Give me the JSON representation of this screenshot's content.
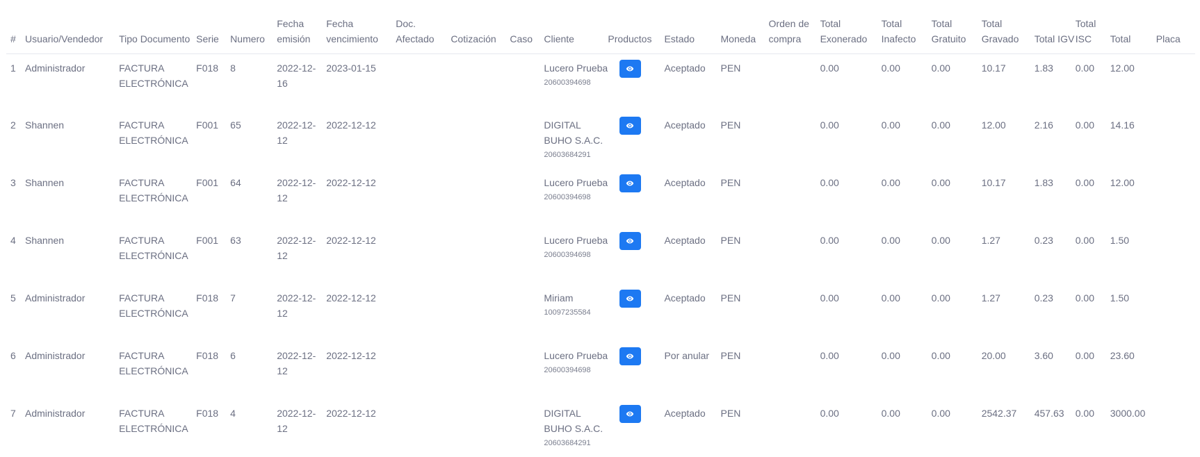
{
  "headers": [
    {
      "key": "idx",
      "label": "#"
    },
    {
      "key": "user",
      "label": "Usuario/Vendedor"
    },
    {
      "key": "tipo",
      "label": "Tipo Documento"
    },
    {
      "key": "serie",
      "label": "Serie"
    },
    {
      "key": "numero",
      "label": "Numero"
    },
    {
      "key": "emision",
      "label": "Fecha emisión"
    },
    {
      "key": "venc",
      "label": "Fecha vencimiento"
    },
    {
      "key": "afectado",
      "label": "Doc. Afectado"
    },
    {
      "key": "cotizacion",
      "label": "Cotización"
    },
    {
      "key": "caso",
      "label": "Caso"
    },
    {
      "key": "cliente",
      "label": "Cliente"
    },
    {
      "key": "productos",
      "label": "Productos"
    },
    {
      "key": "estado",
      "label": "Estado"
    },
    {
      "key": "moneda",
      "label": "Moneda"
    },
    {
      "key": "orden",
      "label": "Orden de compra"
    },
    {
      "key": "exonerado",
      "label": "Total Exonerado"
    },
    {
      "key": "inafecto",
      "label": "Total Inafecto"
    },
    {
      "key": "gratuito",
      "label": "Total Gratuito"
    },
    {
      "key": "gravado",
      "label": "Total Gravado"
    },
    {
      "key": "igv",
      "label": "Total IGV"
    },
    {
      "key": "isc",
      "label": "Total ISC"
    },
    {
      "key": "total",
      "label": "Total"
    },
    {
      "key": "placa",
      "label": "Placa"
    }
  ],
  "rows": [
    {
      "idx": "1",
      "user": "Administrador",
      "tipo": "FACTURA ELECTRÓNICA",
      "serie": "F018",
      "numero": "8",
      "emision": "2022-12-16",
      "venc": "2023-01-15",
      "afectado": "",
      "cotizacion": "",
      "caso": "",
      "cliente_name": "Lucero Prueba",
      "cliente_ruc": "20600394698",
      "estado": "Aceptado",
      "moneda": "PEN",
      "orden": "",
      "exonerado": "0.00",
      "inafecto": "0.00",
      "gratuito": "0.00",
      "gravado": "10.17",
      "igv": "1.83",
      "isc": "0.00",
      "total": "12.00",
      "placa": ""
    },
    {
      "idx": "2",
      "user": "Shannen",
      "tipo": "FACTURA ELECTRÓNICA",
      "serie": "F001",
      "numero": "65",
      "emision": "2022-12-12",
      "venc": "2022-12-12",
      "afectado": "",
      "cotizacion": "",
      "caso": "",
      "cliente_name": "DIGITAL BUHO S.A.C.",
      "cliente_ruc": "20603684291",
      "estado": "Aceptado",
      "moneda": "PEN",
      "orden": "",
      "exonerado": "0.00",
      "inafecto": "0.00",
      "gratuito": "0.00",
      "gravado": "12.00",
      "igv": "2.16",
      "isc": "0.00",
      "total": "14.16",
      "placa": ""
    },
    {
      "idx": "3",
      "user": "Shannen",
      "tipo": "FACTURA ELECTRÓNICA",
      "serie": "F001",
      "numero": "64",
      "emision": "2022-12-12",
      "venc": "2022-12-12",
      "afectado": "",
      "cotizacion": "",
      "caso": "",
      "cliente_name": "Lucero Prueba",
      "cliente_ruc": "20600394698",
      "estado": "Aceptado",
      "moneda": "PEN",
      "orden": "",
      "exonerado": "0.00",
      "inafecto": "0.00",
      "gratuito": "0.00",
      "gravado": "10.17",
      "igv": "1.83",
      "isc": "0.00",
      "total": "12.00",
      "placa": ""
    },
    {
      "idx": "4",
      "user": "Shannen",
      "tipo": "FACTURA ELECTRÓNICA",
      "serie": "F001",
      "numero": "63",
      "emision": "2022-12-12",
      "venc": "2022-12-12",
      "afectado": "",
      "cotizacion": "",
      "caso": "",
      "cliente_name": "Lucero Prueba",
      "cliente_ruc": "20600394698",
      "estado": "Aceptado",
      "moneda": "PEN",
      "orden": "",
      "exonerado": "0.00",
      "inafecto": "0.00",
      "gratuito": "0.00",
      "gravado": "1.27",
      "igv": "0.23",
      "isc": "0.00",
      "total": "1.50",
      "placa": ""
    },
    {
      "idx": "5",
      "user": "Administrador",
      "tipo": "FACTURA ELECTRÓNICA",
      "serie": "F018",
      "numero": "7",
      "emision": "2022-12-12",
      "venc": "2022-12-12",
      "afectado": "",
      "cotizacion": "",
      "caso": "",
      "cliente_name": "Miriam",
      "cliente_ruc": "10097235584",
      "estado": "Aceptado",
      "moneda": "PEN",
      "orden": "",
      "exonerado": "0.00",
      "inafecto": "0.00",
      "gratuito": "0.00",
      "gravado": "1.27",
      "igv": "0.23",
      "isc": "0.00",
      "total": "1.50",
      "placa": ""
    },
    {
      "idx": "6",
      "user": "Administrador",
      "tipo": "FACTURA ELECTRÓNICA",
      "serie": "F018",
      "numero": "6",
      "emision": "2022-12-12",
      "venc": "2022-12-12",
      "afectado": "",
      "cotizacion": "",
      "caso": "",
      "cliente_name": "Lucero Prueba",
      "cliente_ruc": "20600394698",
      "estado": "Por anular",
      "moneda": "PEN",
      "orden": "",
      "exonerado": "0.00",
      "inafecto": "0.00",
      "gratuito": "0.00",
      "gravado": "20.00",
      "igv": "3.60",
      "isc": "0.00",
      "total": "23.60",
      "placa": ""
    },
    {
      "idx": "7",
      "user": "Administrador",
      "tipo": "FACTURA ELECTRÓNICA",
      "serie": "F018",
      "numero": "4",
      "emision": "2022-12-12",
      "venc": "2022-12-12",
      "afectado": "",
      "cotizacion": "",
      "caso": "",
      "cliente_name": "DIGITAL BUHO S.A.C.",
      "cliente_ruc": "20603684291",
      "estado": "Aceptado",
      "moneda": "PEN",
      "orden": "",
      "exonerado": "0.00",
      "inafecto": "0.00",
      "gratuito": "0.00",
      "gravado": "2542.37",
      "igv": "457.63",
      "isc": "0.00",
      "total": "3000.00",
      "placa": ""
    }
  ],
  "products_button": {
    "icon": "eye-icon",
    "color": "#1d79f2"
  }
}
